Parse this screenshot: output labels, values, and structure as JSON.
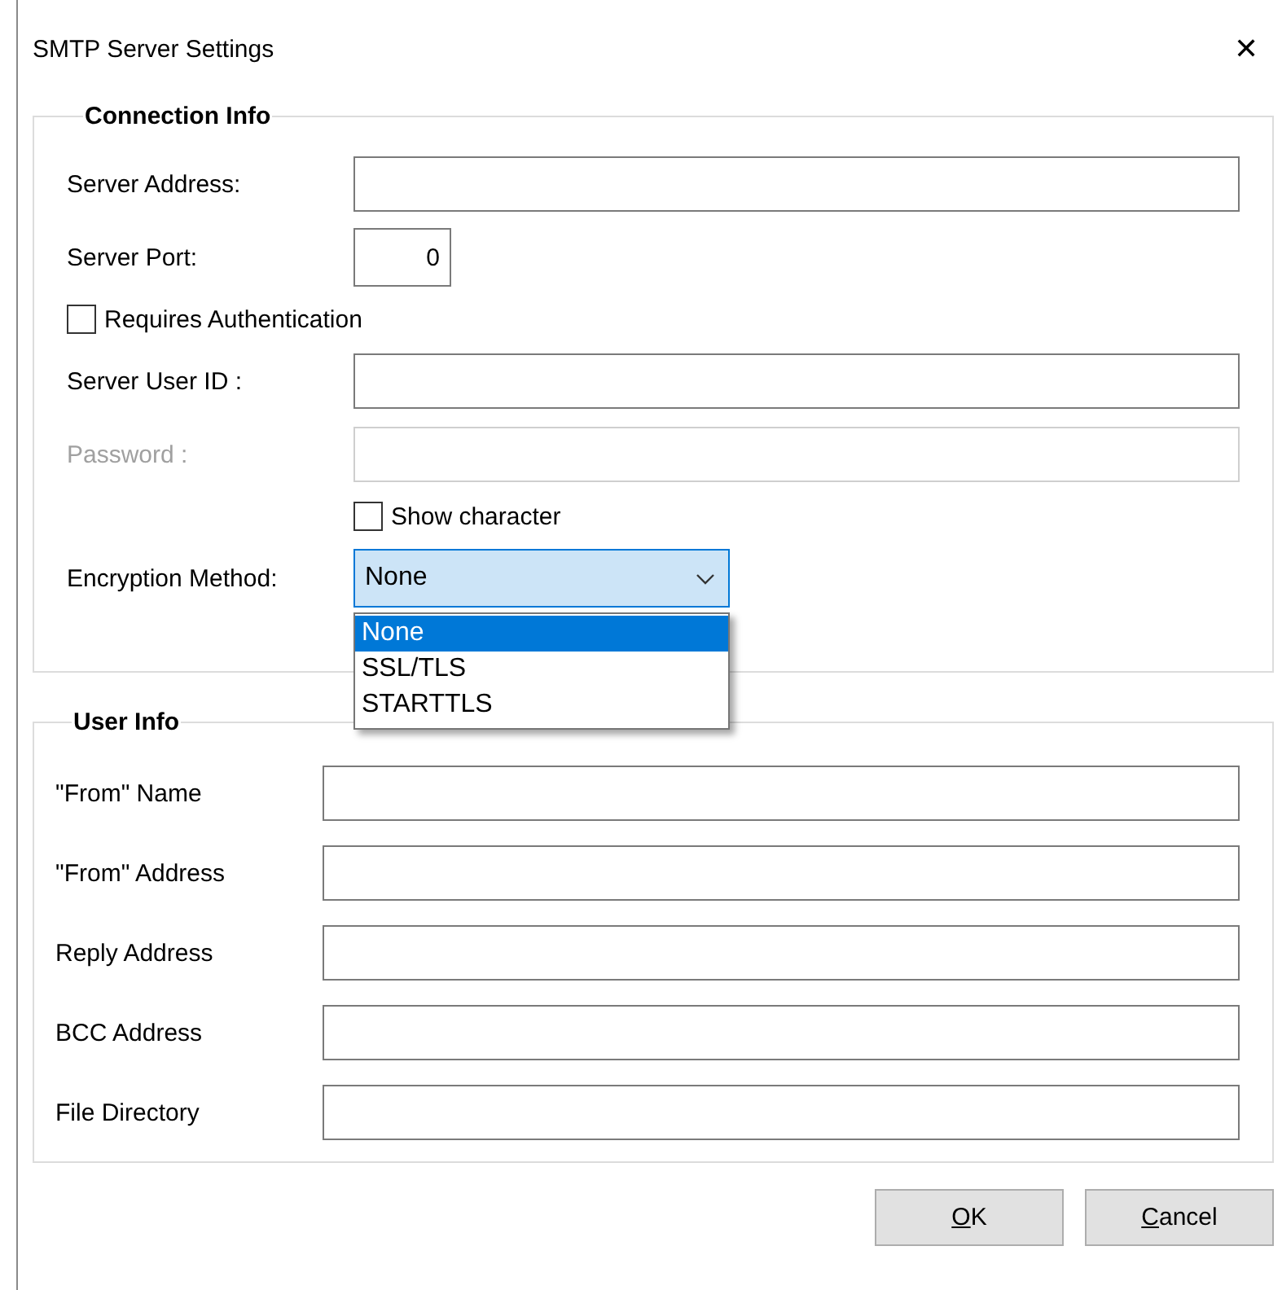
{
  "window": {
    "title": "SMTP Server Settings",
    "close": "✕"
  },
  "connection_info": {
    "title": "Connection Info",
    "rows": [
      {
        "kind": "field",
        "label": "Server Address:",
        "value": "",
        "disabled": false
      },
      {
        "kind": "port",
        "label": "Server Port:",
        "value": "0",
        "disabled": false
      },
      {
        "kind": "checkbox",
        "label": "Requires Authentication",
        "checked": false
      },
      {
        "kind": "field",
        "label": "Server User ID :",
        "value": "",
        "disabled": false
      },
      {
        "kind": "field",
        "label": "Password :",
        "value": "",
        "disabled": true
      },
      {
        "kind": "checkbox_indented",
        "label": "Show character",
        "checked": false
      },
      {
        "kind": "combo",
        "label": "Encryption Method:",
        "value": "None",
        "expanded": true,
        "options": [
          {
            "label": "None",
            "selected": true
          },
          {
            "label": "SSL/TLS",
            "selected": false
          },
          {
            "label": "STARTTLS",
            "selected": false
          }
        ]
      }
    ]
  },
  "user_info": {
    "title": "User Info",
    "rows": [
      {
        "label": "\"From\" Name",
        "value": ""
      },
      {
        "label": "\"From\" Address",
        "value": ""
      },
      {
        "label": "Reply Address",
        "value": ""
      },
      {
        "label": "BCC Address",
        "value": ""
      },
      {
        "label": "File Directory",
        "value": ""
      }
    ]
  },
  "buttons": [
    {
      "label": "OK",
      "access_key_underlined": true
    },
    {
      "label": "Cancel",
      "access_key_underlined": true
    }
  ]
}
